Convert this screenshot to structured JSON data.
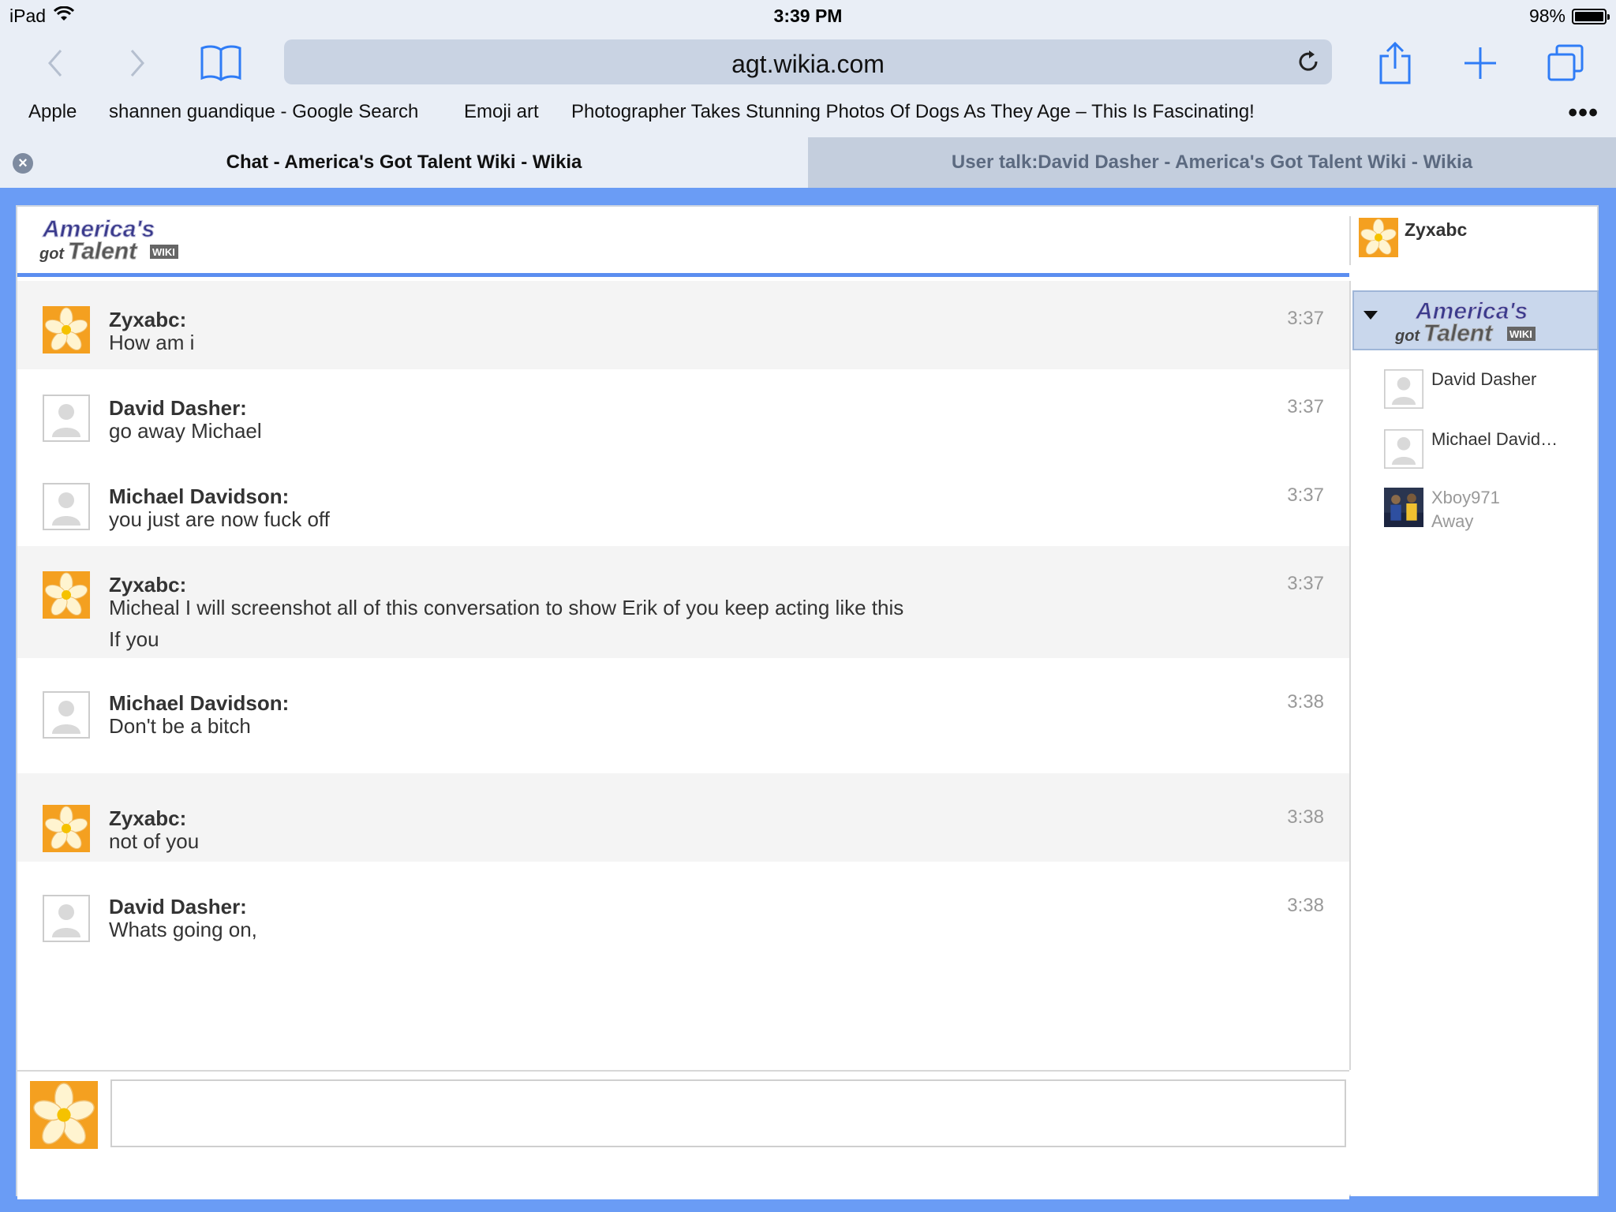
{
  "status_bar": {
    "device": "iPad",
    "time": "3:39 PM",
    "battery": "98%"
  },
  "toolbar": {
    "url": "agt.wikia.com"
  },
  "bookmarks": [
    "Apple",
    "shannen guandique - Google Search",
    "Emoji art",
    "Photographer Takes Stunning Photos Of Dogs As They Age – This Is Fascinating!"
  ],
  "tabs": [
    {
      "label": "Chat - America's Got Talent Wiki - Wikia",
      "active": true
    },
    {
      "label": "User talk:David Dasher - America's Got Talent Wiki - Wikia",
      "active": false
    }
  ],
  "chat": {
    "current_user": "Zyxabc",
    "logo_text": "America's got Talent WIKI",
    "messages": [
      {
        "author": "Zyxabc:",
        "text": [
          "How am i"
        ],
        "time": "3:37",
        "avatar": "flower-avatar"
      },
      {
        "author": "David Dasher:",
        "text": [
          "go away Michael"
        ],
        "time": "3:37",
        "avatar": "default-avatar"
      },
      {
        "author": "Michael Davidson:",
        "text": [
          "you just are now fuck off"
        ],
        "time": "3:37",
        "avatar": "default-avatar"
      },
      {
        "author": "Zyxabc:",
        "text": [
          "Micheal I will screenshot all of this conversation to show Erik of you keep acting like this",
          "If you"
        ],
        "time": "3:37",
        "avatar": "flower-avatar"
      },
      {
        "author": "Michael Davidson:",
        "text": [
          "Don't be a bitch"
        ],
        "time": "3:38",
        "avatar": "default-avatar"
      },
      {
        "author": "Zyxabc:",
        "text": [
          "not of you"
        ],
        "time": "3:38",
        "avatar": "flower-avatar"
      },
      {
        "author": "David Dasher:",
        "text": [
          "Whats going on,"
        ],
        "time": "3:38",
        "avatar": "default-avatar"
      }
    ],
    "users": [
      {
        "name": "David Dasher",
        "status": "",
        "avatar": "default-avatar"
      },
      {
        "name": "Michael David…",
        "status": "",
        "avatar": "default-avatar"
      },
      {
        "name": "Xboy971",
        "status": "Away",
        "avatar": "photo-avatar"
      }
    ]
  },
  "colors": {
    "page_background": "#6a9cf5",
    "header_rule": "#5b8ef0",
    "tab_inactive": "#c4cedd",
    "ios_blue": "#2f7cf6"
  }
}
